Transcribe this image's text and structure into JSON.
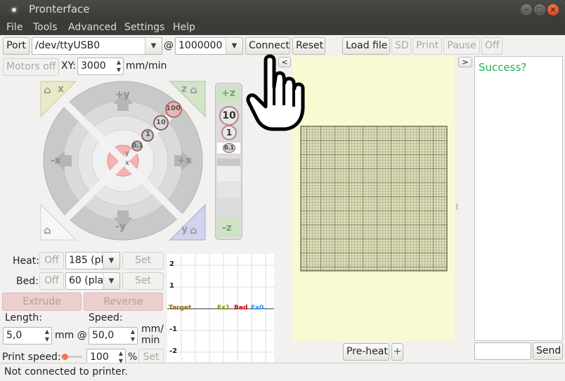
{
  "window": {
    "title": "Pronterface"
  },
  "menu": {
    "file": "File",
    "tools": "Tools",
    "advanced": "Advanced",
    "settings": "Settings",
    "help": "Help"
  },
  "toolbar": {
    "port_label": "Port",
    "port_value": "/dev/ttyUSB0",
    "at": "@",
    "baud_value": "1000000",
    "connect_label": "Connect",
    "reset_label": "Reset",
    "load_file_label": "Load file",
    "sd_label": "SD",
    "print_label": "Print",
    "pause_label": "Pause",
    "off_label": "Off"
  },
  "motion": {
    "motors_off_label": "Motors off",
    "xy_label": "XY:",
    "xy_value": "3000",
    "xy_unit": "mm/min",
    "home_x": "x",
    "home_z": "z",
    "home_y": "y",
    "plus_y": "+y",
    "minus_y": "-y",
    "plus_x": "+x",
    "minus_x": "-x",
    "center_y": "y",
    "center_x": "x",
    "steps": [
      "100",
      "10",
      "1",
      "0.1"
    ],
    "plus_z": "+z",
    "minus_z": "-z",
    "z_steps": [
      "10",
      "1",
      "0.1"
    ],
    "collapse_label": "<"
  },
  "temps": {
    "heat_label": "Heat:",
    "heat_off": "Off",
    "heat_value": "185 (pl",
    "set_label": "Set",
    "bed_label": "Bed:",
    "bed_off": "Off",
    "bed_value": "60 (pla",
    "extrude_label": "Extrude",
    "reverse_label": "Reverse",
    "length_label": "Length:",
    "speed_label": "Speed:",
    "length_value": "5,0",
    "mm_at": "mm @",
    "speed_value": "50,0",
    "speed_unit": "mm/\nmin",
    "print_speed_label": "Print speed:",
    "print_speed_value": "100",
    "percent": "%",
    "print_speed_set": "Set"
  },
  "graph": {
    "ticks": [
      "2",
      "1",
      "-1",
      "-2"
    ],
    "legend": [
      {
        "name": "Target",
        "color": "#8b6508"
      },
      {
        "name": "Ex1",
        "color": "#8b8b00"
      },
      {
        "name": "Bed",
        "color": "#d00000"
      },
      {
        "name": "Ex0",
        "color": "#1e90ff"
      }
    ]
  },
  "preview": {
    "preheat_label": "Pre-heat",
    "plus_label": "+"
  },
  "console": {
    "expand_label": ">",
    "message": "Success?",
    "message_color": "#22b14c",
    "send_label": "Send",
    "input_value": ""
  },
  "status": {
    "text": "Not connected to printer."
  }
}
